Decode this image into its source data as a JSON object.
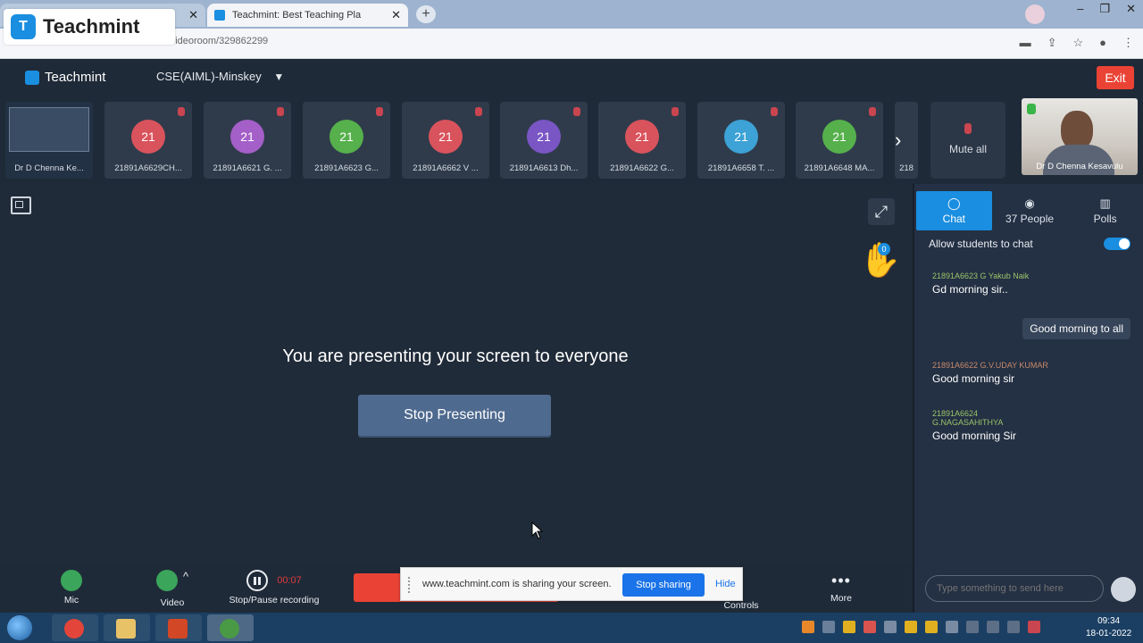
{
  "browser": {
    "tab1_title": "",
    "tab2_title": "Teachmint: Best Teaching Pla",
    "url": "teachmint.com/nvideoroom/329862299",
    "brand_overlay": "Teachmint"
  },
  "app": {
    "logo_text": "Teachmint",
    "class_name": "CSE(AIML)-Minskey",
    "exit_label": "Exit"
  },
  "participants": [
    {
      "avatar": "",
      "label": "Dr D Chenna Ke...",
      "type": "screen"
    },
    {
      "avatar": "21",
      "label": "21891A6629CH...",
      "color": "#d9535c"
    },
    {
      "avatar": "21",
      "label": "21891A6621 G. ...",
      "color": "#a55fc8"
    },
    {
      "avatar": "21",
      "label": "21891A6623 G...",
      "color": "#56b04c"
    },
    {
      "avatar": "21",
      "label": "21891A6662 V ...",
      "color": "#d9535c"
    },
    {
      "avatar": "21",
      "label": "21891A6613 Dh...",
      "color": "#7956c4"
    },
    {
      "avatar": "21",
      "label": "21891A6622 G...",
      "color": "#d9535c"
    },
    {
      "avatar": "21",
      "label": "21891A6658 T. ...",
      "color": "#3da2d6"
    },
    {
      "avatar": "21",
      "label": "21891A6648 MA...",
      "color": "#56b04c"
    },
    {
      "avatar": "",
      "label": "218",
      "color": "#2f3b4b"
    }
  ],
  "strip": {
    "mute_all_label": "Mute all",
    "host_name": "Dr D Chenna Kesavulu"
  },
  "stage": {
    "message": "You are presenting your screen to everyone",
    "stop_presenting_label": "Stop Presenting",
    "hand_raise_count": "0"
  },
  "panel": {
    "tabs": [
      {
        "label": "Chat",
        "icon": "chat-icon"
      },
      {
        "label": "37 People",
        "icon": "people-icon"
      },
      {
        "label": "Polls",
        "icon": "polls-icon"
      }
    ],
    "allow_label": "Allow students to chat",
    "messages": [
      {
        "sender": "21891A6623 G Yakub Naik",
        "text": "Gd morning sir.."
      },
      {
        "sender": "21891A6622 G.V.UDAY KUMAR",
        "text": "Good morning sir"
      },
      {
        "sender": "21891A6624 G.NAGASAHITHYA",
        "text": "Good morning Sir"
      }
    ],
    "outgoing": "Good morning to all",
    "input_placeholder": "Type something to send here"
  },
  "controls": {
    "mic_label": "Mic",
    "video_label": "Video",
    "record_label": "Stop/Pause recording",
    "record_timer": "00:07",
    "class_controls_label": "Controls",
    "more_label": "More"
  },
  "share_bar": {
    "text": "www.teachmint.com is sharing your screen.",
    "stop_label": "Stop sharing",
    "hide_label": "Hide"
  },
  "taskbar": {
    "time": "09:34",
    "date": "18-01-2022"
  }
}
